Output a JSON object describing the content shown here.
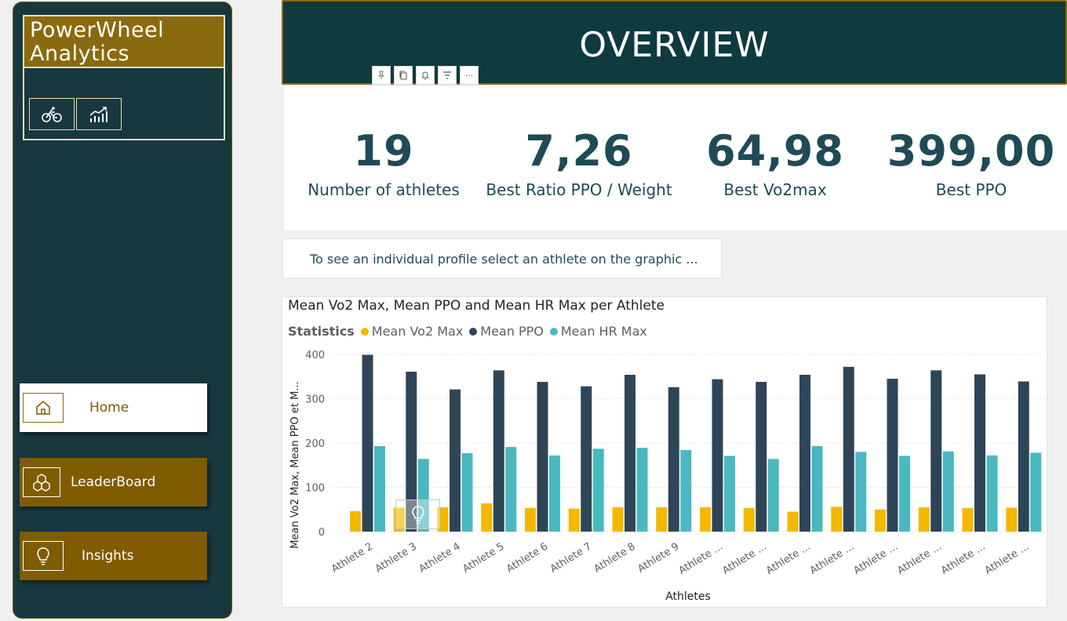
{
  "brand": {
    "line1": "PowerWheel",
    "line2": "Analytics"
  },
  "brand_icons": [
    "bicycle-icon",
    "line-chart-icon"
  ],
  "nav": [
    {
      "label": "Home",
      "icon": "home-icon",
      "active": true
    },
    {
      "label": "LeaderBoard",
      "icon": "cubes-icon",
      "active": false
    },
    {
      "label": "Insights",
      "icon": "lightbulb-icon",
      "active": false
    }
  ],
  "header": {
    "title": "OVERVIEW"
  },
  "toolbar": [
    "pin-icon",
    "copy-icon",
    "bell-icon",
    "filter-icon",
    "more-icon"
  ],
  "toolbar_more": "···",
  "kpis": [
    {
      "value": "19",
      "label": "Number of athletes"
    },
    {
      "value": "7,26",
      "label": "Best Ratio PPO / Weight"
    },
    {
      "value": "64,98",
      "label": "Best  Vo2max"
    },
    {
      "value": "399,00",
      "label": "Best PPO"
    }
  ],
  "hint": "To see an individual profile select an athlete on the graphic ...",
  "colors": {
    "vo2": "#f5b800",
    "ppo": "#2e4558",
    "hr": "#4ab8c0",
    "brand_gold": "#8a6a0e",
    "sidebar": "#16383e"
  },
  "chart_data": {
    "type": "bar",
    "title": "Mean Vo2 Max, Mean PPO and Mean HR Max per Athlete",
    "legend_title": "Statistics",
    "xlabel": "Athletes",
    "ylabel": "Mean Vo2 Max, Mean PPO et M...",
    "ylim": [
      0,
      400
    ],
    "yticks": [
      0,
      100,
      200,
      300,
      400
    ],
    "grid": true,
    "legend_position": "top-left",
    "categories": [
      "Athlete 2",
      "Athlete 3",
      "Athlete 4",
      "Athlete 5",
      "Athlete 6",
      "Athlete 7",
      "Athlete 8",
      "Athlete 9",
      "Athlete ...",
      "Athlete ...",
      "Athlete ...",
      "Athlete ...",
      "Athlete ...",
      "Athlete ...",
      "Athlete ...",
      "Athlete ..."
    ],
    "series": [
      {
        "name": "Mean Vo2 Max",
        "values": [
          46,
          54,
          55,
          64,
          53,
          52,
          55,
          55,
          55,
          53,
          45,
          56,
          50,
          55,
          53,
          54
        ]
      },
      {
        "name": "Mean PPO",
        "values": [
          399,
          361,
          321,
          364,
          338,
          328,
          354,
          326,
          344,
          338,
          354,
          372,
          345,
          364,
          355,
          339
        ]
      },
      {
        "name": "Mean HR Max",
        "values": [
          193,
          164,
          177,
          191,
          172,
          187,
          189,
          184,
          171,
          164,
          193,
          180,
          171,
          181,
          172,
          178
        ]
      }
    ]
  }
}
